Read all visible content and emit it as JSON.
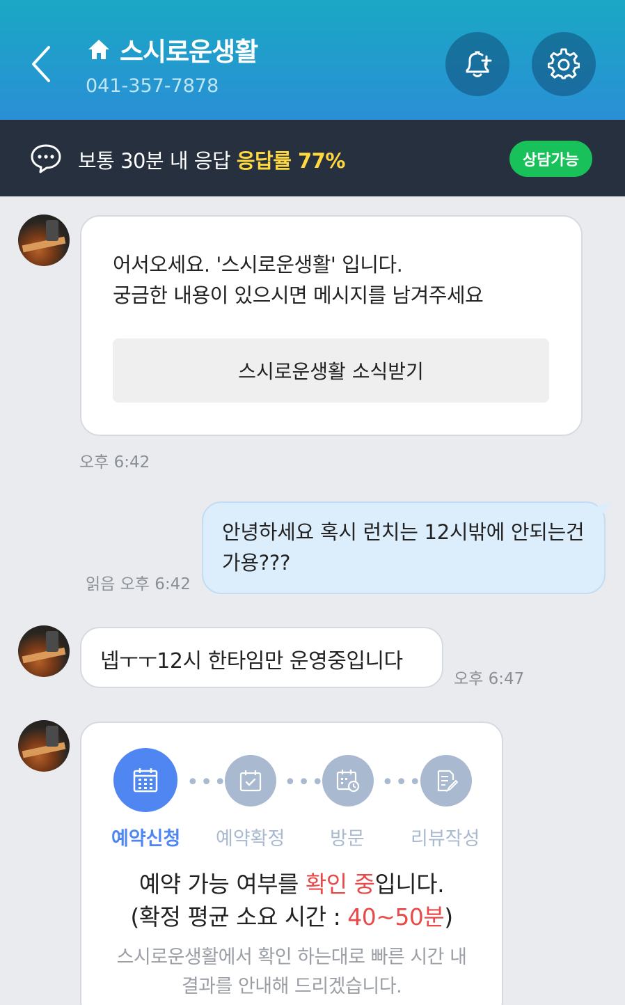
{
  "header": {
    "title": "스시로운생활",
    "phone": "041-357-7878"
  },
  "status": {
    "text": "보통 30분 내 응답",
    "rate": "응답률 77%",
    "badge": "상담가능"
  },
  "messages": [
    {
      "text": "어서오세요. '스시로운생활' 입니다.\n궁금한 내용이 있으시면 메시지를 남겨주세요",
      "button": "스시로운생활 소식받기",
      "time": "오후 6:42"
    },
    {
      "text": "안녕하세요 혹시 런치는 12시밖에 안되는건가용???",
      "read": "읽음",
      "time": "오후 6:42"
    },
    {
      "text": "넵ㅜㅜ12시 한타임만 운영중입니다",
      "time": "오후 6:47"
    }
  ],
  "reservation": {
    "steps": [
      "예약신청",
      "예약확정",
      "방문",
      "리뷰작성"
    ],
    "active_step": 0,
    "title_pre": "예약 가능 여부를 ",
    "title_highlight": "확인 중",
    "title_post": "입니다.",
    "avg_pre": "(확정 평균 소요 시간 : ",
    "avg_value": "40~50분",
    "avg_post": ")",
    "note_line1": "스시로운생활에서 확인 하는대로 빠른 시간 내",
    "note_line2": "결과를 안내해 드리겠습니다."
  },
  "colors": {
    "header_gradient": [
      "#1aa8c4",
      "#2a8fd6"
    ],
    "status_bg": "#26303f",
    "rate_color": "#ffd93d",
    "badge_color": "#19c15a",
    "active_step": "#4f86f2",
    "highlight_red": "#e84a4a"
  }
}
